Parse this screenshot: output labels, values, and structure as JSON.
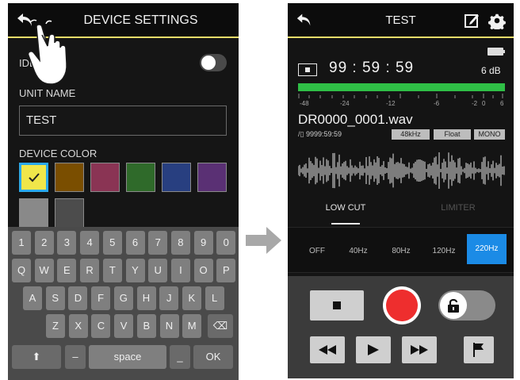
{
  "left_screen": {
    "title": "DEVICE SETTINGS",
    "identify_label": "IDENT",
    "identify_on": false,
    "unit_name_label": "UNIT NAME",
    "unit_name_value": "TEST",
    "device_color_label": "DEVICE COLOR",
    "colors": [
      "#f0e64a",
      "#7a4e00",
      "#8a3454",
      "#2f6a2a",
      "#283f80",
      "#5a3074",
      "#898989",
      "#4c4c4c"
    ],
    "selected_color_index": 0,
    "keyboard": {
      "row1": [
        "1",
        "2",
        "3",
        "4",
        "5",
        "6",
        "7",
        "8",
        "9",
        "0"
      ],
      "row2": [
        "Q",
        "W",
        "E",
        "R",
        "T",
        "Y",
        "U",
        "I",
        "O",
        "P"
      ],
      "row3": [
        "A",
        "S",
        "D",
        "F",
        "G",
        "H",
        "J",
        "K",
        "L"
      ],
      "row4": [
        "Z",
        "X",
        "C",
        "V",
        "B",
        "N",
        "M"
      ],
      "shift": "⬆",
      "dash": "–",
      "space": "space",
      "underscore": "_",
      "ok": "OK",
      "backspace": "⌫"
    }
  },
  "right_screen": {
    "title": "TEST",
    "transport_state": "stop",
    "time": "99 : 59 : 59",
    "gain": "6 dB",
    "meter_level": 1.0,
    "meter_scale": [
      "-48",
      "-24",
      "-12",
      "-6",
      "-2",
      "0",
      "6"
    ],
    "file_name": "DR0000_0001.wav",
    "remaining": "9999:59:59",
    "tags": [
      "48kHz",
      "Float",
      "MONO"
    ],
    "tabs": [
      "LOW CUT",
      "LIMITER"
    ],
    "active_tab": "LOW CUT",
    "filters": [
      "OFF",
      "40Hz",
      "80Hz",
      "120Hz",
      "220Hz"
    ],
    "active_filter": "220Hz",
    "lock_locked": false,
    "colors": {
      "accent": "#1b8be6",
      "meter": "#2fbf46",
      "record": "#ee2e2e",
      "header_line": "#e6dc6a"
    }
  }
}
